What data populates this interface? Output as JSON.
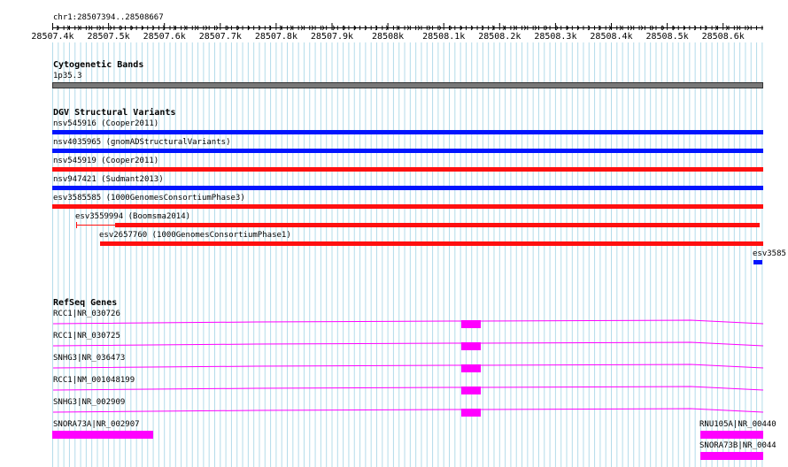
{
  "colors": {
    "grid": "#b4dcea",
    "blue": "#0015ff",
    "red": "#ff1010",
    "magenta": "#ff00ff",
    "band": "#787878",
    "ruler": "#000000"
  },
  "ruler": {
    "position": "chr1:28507394..28508667",
    "ticks": [
      "28507.4k",
      "28507.5k",
      "28507.6k",
      "28507.7k",
      "28507.8k",
      "28507.9k",
      "28508k",
      "28508.1k",
      "28508.2k",
      "28508.3k",
      "28508.4k",
      "28508.5k",
      "28508.6k"
    ]
  },
  "cytoband": {
    "title": "Cytogenetic Bands",
    "band_label": "1p35.3"
  },
  "dgv": {
    "title": "DGV Structural Variants",
    "variants": [
      {
        "label": "nsv545916 (Cooper2011)",
        "color": "blue"
      },
      {
        "label": "nsv4035965 (gnomADStructuralVariants)",
        "color": "blue"
      },
      {
        "label": "nsv545919 (Cooper2011)",
        "color": "red"
      },
      {
        "label": "nsv947421 (Sudmant2013)",
        "color": "blue"
      },
      {
        "label": "esv3585585 (1000GenomesConsortiumPhase3)",
        "color": "red"
      },
      {
        "label": "esv3559994 (Boomsma2014)",
        "color": "red"
      },
      {
        "label": "esv2657760 (1000GenomesConsortiumPhase1)",
        "color": "red"
      },
      {
        "label": "esv3585",
        "color": "blue"
      }
    ]
  },
  "refseq": {
    "title": "RefSeq Genes",
    "genes": [
      {
        "label": "RCC1|NR_030726"
      },
      {
        "label": "RCC1|NR_030725"
      },
      {
        "label": "SNHG3|NR_036473"
      },
      {
        "label": "RCC1|NM_001048199"
      },
      {
        "label": "SNHG3|NR_002909"
      },
      {
        "label": "SNORA73A|NR_002907"
      },
      {
        "label": "RNU105A|NR_00440"
      },
      {
        "label": "SNORA73B|NR_0044"
      }
    ]
  }
}
